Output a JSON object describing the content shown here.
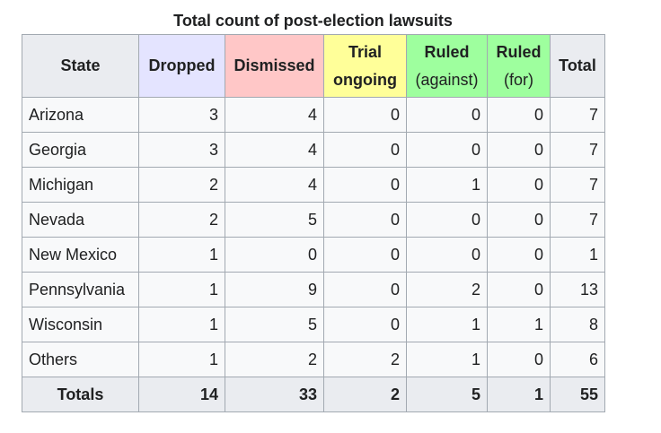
{
  "table": {
    "caption": "Total count of post-election lawsuits",
    "header_colors": {
      "state": "#eaecf0",
      "dropped": "#e4e4ff",
      "dismissed": "#ffc7c7",
      "trial": "#ffff99",
      "ruled_against": "#9eff9e",
      "ruled_for": "#9eff9e",
      "total": "#eaecf0"
    },
    "headers": {
      "state": "State",
      "dropped": "Dropped",
      "dismissed": "Dismissed",
      "trial_line1": "Trial",
      "trial_line2": "ongoing",
      "ruled_against_line1": "Ruled",
      "ruled_against_line2": "(against)",
      "ruled_for_line1": "Ruled",
      "ruled_for_line2": "(for)",
      "total": "Total"
    },
    "rows": [
      {
        "state": "Arizona",
        "dropped": "3",
        "dismissed": "4",
        "trial": "0",
        "ruled_against": "0",
        "ruled_for": "0",
        "total": "7"
      },
      {
        "state": "Georgia",
        "dropped": "3",
        "dismissed": "4",
        "trial": "0",
        "ruled_against": "0",
        "ruled_for": "0",
        "total": "7"
      },
      {
        "state": "Michigan",
        "dropped": "2",
        "dismissed": "4",
        "trial": "0",
        "ruled_against": "1",
        "ruled_for": "0",
        "total": "7"
      },
      {
        "state": "Nevada",
        "dropped": "2",
        "dismissed": "5",
        "trial": "0",
        "ruled_against": "0",
        "ruled_for": "0",
        "total": "7"
      },
      {
        "state": "New Mexico",
        "dropped": "1",
        "dismissed": "0",
        "trial": "0",
        "ruled_against": "0",
        "ruled_for": "0",
        "total": "1"
      },
      {
        "state": "Pennsylvania",
        "dropped": "1",
        "dismissed": "9",
        "trial": "0",
        "ruled_against": "2",
        "ruled_for": "0",
        "total": "13"
      },
      {
        "state": "Wisconsin",
        "dropped": "1",
        "dismissed": "5",
        "trial": "0",
        "ruled_against": "1",
        "ruled_for": "1",
        "total": "8"
      },
      {
        "state": "Others",
        "dropped": "1",
        "dismissed": "2",
        "trial": "2",
        "ruled_against": "1",
        "ruled_for": "0",
        "total": "6"
      }
    ],
    "totals": {
      "label": "Totals",
      "dropped": "14",
      "dismissed": "33",
      "trial": "2",
      "ruled_against": "5",
      "ruled_for": "1",
      "total": "55"
    }
  }
}
